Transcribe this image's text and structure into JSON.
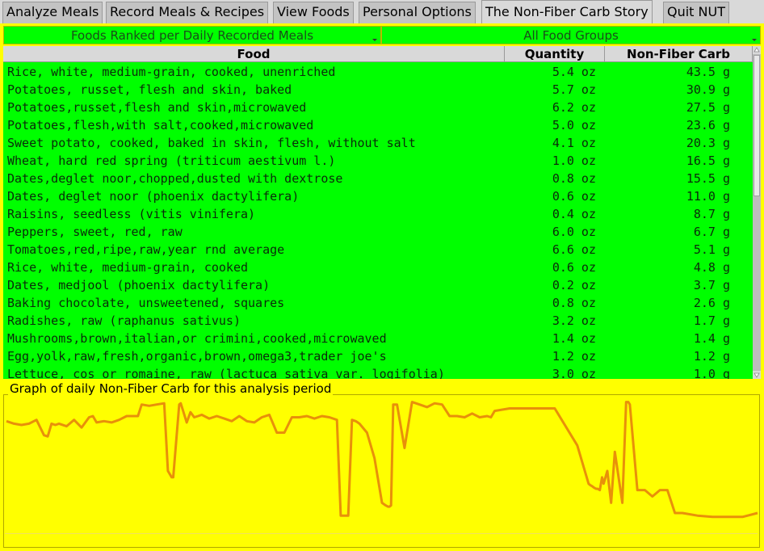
{
  "tabs": [
    {
      "label": "Analyze Meals",
      "active": false
    },
    {
      "label": "Record Meals & Recipes",
      "active": false
    },
    {
      "label": "View Foods",
      "active": false
    },
    {
      "label": "Personal Options",
      "active": false
    },
    {
      "label": "The Non-Fiber Carb Story",
      "active": true
    },
    {
      "label": "Quit NUT",
      "active": false
    }
  ],
  "filters": {
    "ranking": "Foods Ranked per Daily Recorded Meals",
    "food_group": "All Food Groups"
  },
  "table": {
    "columns": [
      "Food",
      "Quantity",
      "Non-Fiber Carb"
    ],
    "rows": [
      {
        "food": "Rice, white, medium-grain, cooked, unenriched",
        "qty": "5.4 oz",
        "nfc": "43.5 g"
      },
      {
        "food": "Potatoes, russet, flesh and skin, baked",
        "qty": "5.7 oz",
        "nfc": "30.9 g"
      },
      {
        "food": "Potatoes,russet,flesh and skin,microwaved",
        "qty": "6.2 oz",
        "nfc": "27.5 g"
      },
      {
        "food": "Potatoes,flesh,with salt,cooked,microwaved",
        "qty": "5.0 oz",
        "nfc": "23.6 g"
      },
      {
        "food": "Sweet potato, cooked, baked in skin, flesh, without salt",
        "qty": "4.1 oz",
        "nfc": "20.3 g"
      },
      {
        "food": "Wheat, hard red spring (triticum aestivum l.)",
        "qty": "1.0 oz",
        "nfc": "16.5 g"
      },
      {
        "food": "Dates,deglet noor,chopped,dusted with dextrose",
        "qty": "0.8 oz",
        "nfc": "15.5 g"
      },
      {
        "food": "Dates, deglet noor (phoenix dactylifera)",
        "qty": "0.6 oz",
        "nfc": "11.0 g"
      },
      {
        "food": "Raisins, seedless (vitis vinifera)",
        "qty": "0.4 oz",
        "nfc": "8.7 g"
      },
      {
        "food": "Peppers, sweet, red, raw",
        "qty": "6.0 oz",
        "nfc": "6.7 g"
      },
      {
        "food": "Tomatoes,red,ripe,raw,year rnd average",
        "qty": "6.6 oz",
        "nfc": "5.1 g"
      },
      {
        "food": "Rice, white, medium-grain, cooked",
        "qty": "0.6 oz",
        "nfc": "4.8 g"
      },
      {
        "food": "Dates, medjool (phoenix dactylifera)",
        "qty": "0.2 oz",
        "nfc": "3.7 g"
      },
      {
        "food": "Baking chocolate, unsweetened, squares",
        "qty": "0.8 oz",
        "nfc": "2.6 g"
      },
      {
        "food": "Radishes, raw (raphanus sativus)",
        "qty": "3.2 oz",
        "nfc": "1.7 g"
      },
      {
        "food": "Mushrooms,brown,italian,or crimini,cooked,microwaved",
        "qty": "1.4 oz",
        "nfc": "1.4 g"
      },
      {
        "food": "Egg,yolk,raw,fresh,organic,brown,omega3,trader joe's",
        "qty": "1.2 oz",
        "nfc": "1.2 g"
      },
      {
        "food": "Lettuce, cos or romaine, raw (lactuca sativa var. logifolia)",
        "qty": "3.0 oz",
        "nfc": "1.0 g"
      }
    ]
  },
  "graph": {
    "title": "Graph of daily Non-Fiber Carb for this analysis period",
    "line_color": "#e8900a",
    "background_color": "#ffff00"
  },
  "chart_data": {
    "type": "line",
    "title": "Graph of daily Non-Fiber Carb for this analysis period",
    "xlabel": "",
    "ylabel": "",
    "grid": false,
    "note": "Unlabeled axes; values are relative (0 = bottom of plot, 1 = top of plot), sampled left to right across the analysis period.",
    "ylim": [
      0,
      1
    ],
    "x": [
      0.0,
      0.01,
      0.02,
      0.03,
      0.04,
      0.05,
      0.055,
      0.06,
      0.065,
      0.07,
      0.08,
      0.09,
      0.1,
      0.11,
      0.115,
      0.12,
      0.13,
      0.14,
      0.15,
      0.16,
      0.17,
      0.175,
      0.18,
      0.19,
      0.2,
      0.21,
      0.215,
      0.22,
      0.222,
      0.23,
      0.232,
      0.24,
      0.245,
      0.25,
      0.255,
      0.26,
      0.27,
      0.28,
      0.29,
      0.3,
      0.31,
      0.32,
      0.33,
      0.34,
      0.35,
      0.36,
      0.37,
      0.38,
      0.39,
      0.4,
      0.41,
      0.42,
      0.43,
      0.44,
      0.445,
      0.45,
      0.455,
      0.46,
      0.465,
      0.47,
      0.48,
      0.49,
      0.5,
      0.505,
      0.508,
      0.51,
      0.512,
      0.515,
      0.52,
      0.53,
      0.54,
      0.55,
      0.56,
      0.57,
      0.58,
      0.59,
      0.6,
      0.61,
      0.62,
      0.63,
      0.64,
      0.645,
      0.65,
      0.67,
      0.7,
      0.73,
      0.76,
      0.775,
      0.777,
      0.78,
      0.782,
      0.785,
      0.787,
      0.79,
      0.793,
      0.795,
      0.8,
      0.805,
      0.81,
      0.82,
      0.825,
      0.828,
      0.83,
      0.84,
      0.85,
      0.86,
      0.87,
      0.88,
      0.89,
      0.9,
      0.92,
      0.94,
      0.96,
      0.98,
      1.0
    ],
    "values": [
      0.84,
      0.82,
      0.81,
      0.82,
      0.85,
      0.73,
      0.72,
      0.82,
      0.81,
      0.82,
      0.8,
      0.85,
      0.79,
      0.87,
      0.88,
      0.83,
      0.84,
      0.83,
      0.85,
      0.88,
      0.88,
      0.88,
      0.97,
      0.96,
      0.97,
      0.98,
      0.45,
      0.4,
      0.4,
      0.97,
      0.98,
      0.83,
      0.91,
      0.87,
      0.88,
      0.89,
      0.86,
      0.88,
      0.86,
      0.84,
      0.88,
      0.84,
      0.83,
      0.87,
      0.89,
      0.75,
      0.75,
      0.87,
      0.87,
      0.88,
      0.86,
      0.88,
      0.87,
      0.85,
      0.1,
      0.1,
      0.1,
      0.85,
      0.84,
      0.82,
      0.75,
      0.55,
      0.2,
      0.18,
      0.17,
      0.17,
      0.18,
      0.97,
      0.97,
      0.63,
      0.99,
      0.97,
      0.95,
      0.98,
      0.97,
      0.88,
      0.88,
      0.87,
      0.9,
      0.87,
      0.88,
      0.87,
      0.92,
      0.94,
      0.94,
      0.94,
      0.65,
      0.35,
      0.34,
      0.33,
      0.32,
      0.31,
      0.31,
      0.3,
      0.4,
      0.35,
      0.45,
      0.2,
      0.6,
      0.2,
      0.99,
      0.99,
      0.97,
      0.3,
      0.3,
      0.25,
      0.3,
      0.3,
      0.12,
      0.12,
      0.1,
      0.09,
      0.09,
      0.09,
      0.12,
      0.09,
      0.09,
      0.09,
      0.08,
      0.08
    ]
  }
}
